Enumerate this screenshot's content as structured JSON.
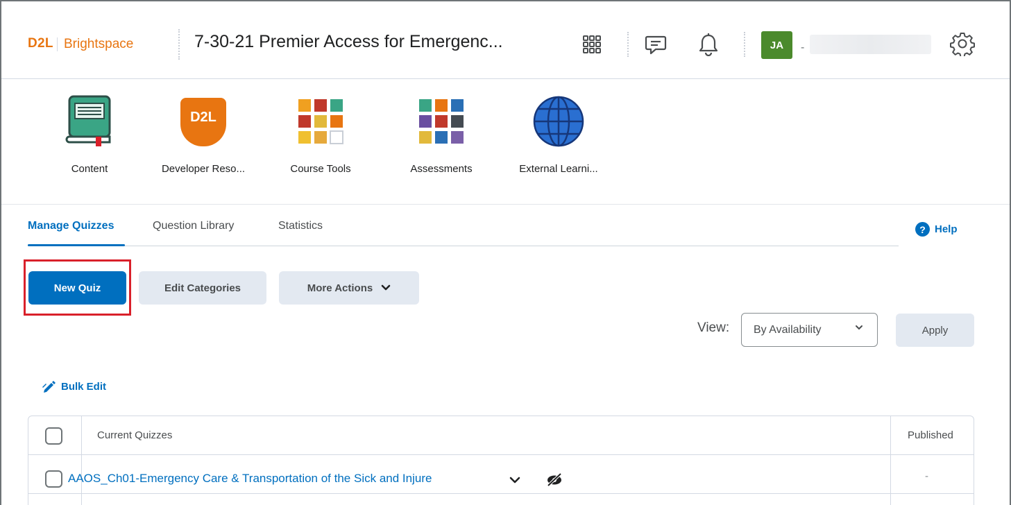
{
  "header": {
    "logo_d2l": "D2L",
    "logo_brightspace": "Brightspace",
    "course_title": "7-30-21 Premier Access for Emergenc...",
    "avatar_initials": "JA",
    "user_dash": "-",
    "icons": [
      "waffle-grid-icon",
      "message-alerts-icon",
      "bell-icon",
      "gear-icon"
    ]
  },
  "navbar": {
    "items": [
      {
        "label": "Content",
        "icon": "book-icon"
      },
      {
        "label": "Developer Reso...",
        "icon": "d2l-logo-icon"
      },
      {
        "label": "Course Tools",
        "icon": "course-tools-icon"
      },
      {
        "label": "Assessments",
        "icon": "assessments-icon"
      },
      {
        "label": "External Learni...",
        "icon": "globe-icon"
      }
    ]
  },
  "tabs": [
    {
      "label": "Manage Quizzes",
      "active": true
    },
    {
      "label": "Question Library",
      "active": false
    },
    {
      "label": "Statistics",
      "active": false
    }
  ],
  "help_label": "Help",
  "actions": {
    "new_quiz": "New Quiz",
    "edit_categories": "Edit Categories",
    "more_actions": "More Actions"
  },
  "view": {
    "label": "View:",
    "selected": "By Availability",
    "apply": "Apply"
  },
  "bulk_edit": "Bulk Edit",
  "table": {
    "headers": {
      "name": "Current Quizzes",
      "published": "Published"
    },
    "rows": [
      {
        "name": "AAOS_Ch01-Emergency Care & Transportation of the Sick and Injure",
        "published": "-"
      }
    ]
  },
  "colors": {
    "brand_orange": "#e87511",
    "primary_blue": "#006fbf",
    "avatar_green": "#4b8a2c",
    "highlight_red": "#d9202a"
  }
}
